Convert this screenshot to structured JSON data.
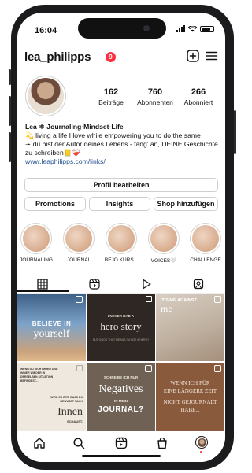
{
  "status": {
    "time": "16:04"
  },
  "header": {
    "username": "lea_philipps",
    "badge": "9"
  },
  "stats": [
    {
      "number": "162",
      "label": "Beiträge"
    },
    {
      "number": "760",
      "label": "Abonnenten"
    },
    {
      "number": "266",
      "label": "Abonniert"
    }
  ],
  "bio": {
    "name": "Lea ⚛ Journaling·Mindset·Life",
    "line1": "💫 living a life I love while empowering you to do the same",
    "line2": "➛ du bist der Autor deines Lebens - fang' an, DEINE Geschichte zu schreiben📒❤️‍🩹",
    "link": "www.leaphilipps.com/links/"
  },
  "buttons": {
    "edit_profile": "Profil bearbeiten",
    "promotions": "Promotions",
    "insights": "Insights",
    "add_shop": "Shop hinzufügen"
  },
  "highlights": [
    {
      "label": "JOURNALING"
    },
    {
      "label": "JOURNAL"
    },
    {
      "label": "BEJO KURS..."
    },
    {
      "label": "VOICES🤍"
    },
    {
      "label": "CHALLENGE"
    }
  ],
  "posts": [
    {
      "line1": "BELIEVE IN",
      "line2": "yourself"
    },
    {
      "line1": "I NEVER HAD A",
      "line2": "hero story",
      "line3": "BUT GOOD THAT MEANS I'M NOT A HERO?"
    },
    {
      "line1": "IT'S ME AGAINST",
      "line2": "me"
    },
    {
      "line1": "WENN DU DICH IMMER UND IMMER WIEDER IN DERSELBEN SITUATION BEFINDEST...",
      "line2": "WIRD ES ZEIT, DASS DU BEWUSST NACH",
      "line3": "Innen",
      "line4": "SCHAUST."
    },
    {
      "line1": "SCHREIBE ICH NUR",
      "line2": "Negatives",
      "line3": "IN MEIN",
      "line4": "JOURNAL?"
    },
    {
      "line1": "WENN ICH FÜR",
      "line2": "EINE LÄNGERE ZEIT",
      "line3": "NICHT GEJOURNALT",
      "line4": "HABE..."
    }
  ]
}
